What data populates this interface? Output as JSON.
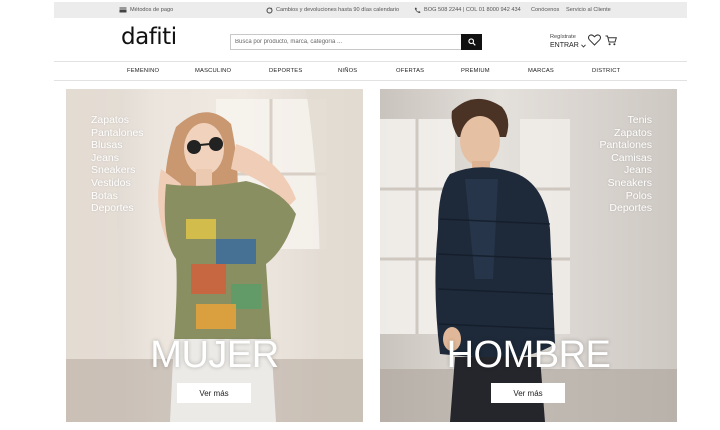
{
  "topbar": {
    "payment": "Métodos de pago",
    "returns": "Cambios y devoluciones hasta 90 días calendario",
    "phone": "BOG 508 2244 | COL 01 8000 942 434",
    "about": "Conócenos",
    "service": "Servicio al Cliente"
  },
  "header": {
    "logo": "dafiti",
    "search_placeholder": "Busca por producto, marca, categoría ...",
    "account_small": "Regístrate",
    "account_big": "ENTRAR"
  },
  "nav": [
    "FEMENINO",
    "MASCULINO",
    "DEPORTES",
    "NIÑOS",
    "OFERTAS",
    "PREMIUM",
    "MARCAS",
    "DISTRICT"
  ],
  "hero_left": {
    "categories": [
      "Zapatos",
      "Pantalones",
      "Blusas",
      "Jeans",
      "Sneakers",
      "Vestidos",
      "Botas",
      "Deportes"
    ],
    "title": "MUJER",
    "cta": "Ver más"
  },
  "hero_right": {
    "categories": [
      "Tenis",
      "Zapatos",
      "Pantalones",
      "Camisas",
      "Jeans",
      "Sneakers",
      "Polos",
      "Deportes"
    ],
    "title": "HOMBRE",
    "cta": "Ver más"
  }
}
